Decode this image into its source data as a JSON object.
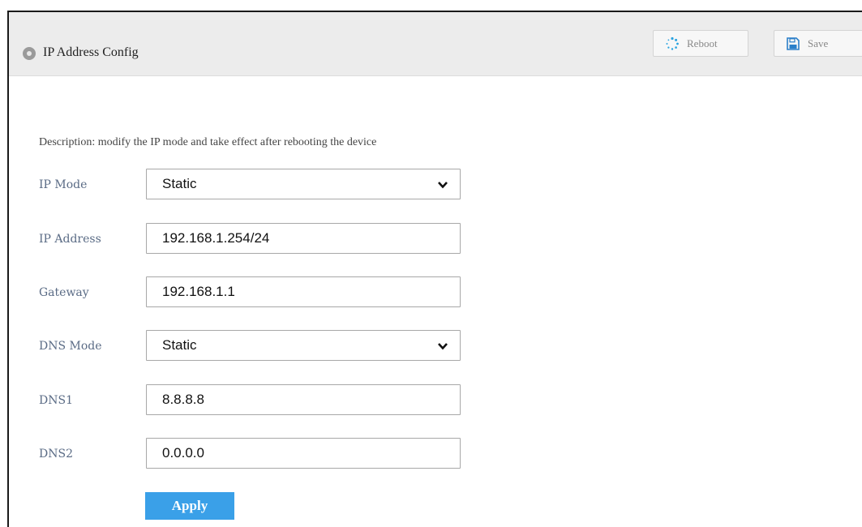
{
  "header": {
    "title": "IP Address Config",
    "reboot_label": "Reboot",
    "save_label": "Save"
  },
  "description": "Description: modify the IP mode and take effect after rebooting the device",
  "form": {
    "ip_mode": {
      "label": "IP Mode",
      "value": "Static"
    },
    "ip_address": {
      "label": "IP Address",
      "value": "192.168.1.254/24"
    },
    "gateway": {
      "label": "Gateway",
      "value": "192.168.1.1"
    },
    "dns_mode": {
      "label": "DNS Mode",
      "value": "Static"
    },
    "dns1": {
      "label": "DNS1",
      "value": "8.8.8.8"
    },
    "dns2": {
      "label": "DNS2",
      "value": "0.0.0.0"
    }
  },
  "apply_label": "Apply",
  "colors": {
    "label_text": "#5a6b85",
    "apply_bg": "#3aa0e8",
    "header_bg": "#ececec",
    "reboot_icon": "#29a3e0",
    "save_icon": "#2a7fc9"
  },
  "icons": {
    "header": "location-pin-icon",
    "reboot": "spinner-icon",
    "save": "floppy-disk-icon",
    "select": "chevron-down-icon"
  }
}
